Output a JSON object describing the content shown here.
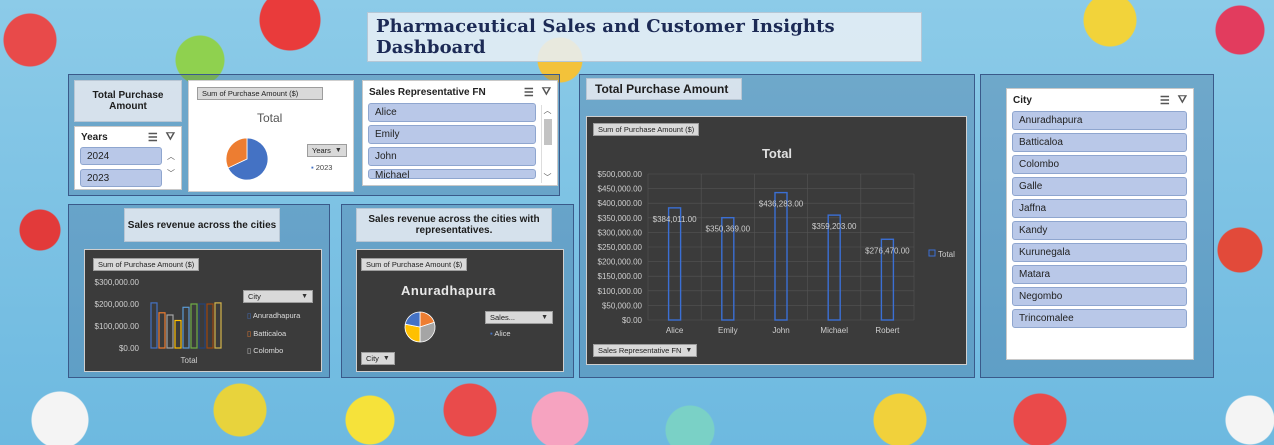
{
  "title": "Pharmaceutical Sales and Customer Insights Dashboard",
  "total_purchase_label": "Total Purchase Amount",
  "years_slicer": {
    "title": "Years",
    "items": [
      "2024",
      "2023"
    ]
  },
  "mini_pie": {
    "field": "Sum of Purchase Amount ($)",
    "title": "Total",
    "dropdown": "Years",
    "legend": "2023",
    "colors": [
      "#4472c4",
      "#ed7d31"
    ]
  },
  "rep_slicer": {
    "title": "Sales Representative FN",
    "items": [
      "Alice",
      "Emily",
      "John",
      "Michael"
    ]
  },
  "city_label": "Sales revenue across the cities",
  "city_chart": {
    "field": "Sum of Purchase Amount ($)",
    "dropdown": "City",
    "legend": [
      "Anuradhapura",
      "Batticaloa",
      "Colombo"
    ],
    "yticks": [
      "$300,000.00",
      "$200,000.00",
      "$100,000.00",
      "$0.00"
    ],
    "xlabel": "Total"
  },
  "rep_city_label": "Sales revenue across the cities with representatives.",
  "rep_city_chart": {
    "field": "Sum of Purchase Amount ($)",
    "title": "Anuradhapura",
    "dropdown": "Sales...",
    "legend": "Alice",
    "city_btn": "City"
  },
  "big_chart_label": "Total Purchase Amount",
  "big_chart_field": "Sum of Purchase Amount ($)",
  "big_chart_axis_btn": "Sales Representative FN",
  "city_slicer": {
    "title": "City",
    "items": [
      "Anuradhapura",
      "Batticaloa",
      "Colombo",
      "Galle",
      "Jaffna",
      "Kandy",
      "Kurunegala",
      "Matara",
      "Negombo",
      "Trincomalee"
    ]
  },
  "icons": {
    "multi_select": "multi-select-icon",
    "clear_filter": "clear-filter-icon"
  },
  "chart_data": [
    {
      "type": "bar",
      "title": "Total",
      "categories": [
        "Alice",
        "Emily",
        "John",
        "Michael",
        "Robert"
      ],
      "values": [
        384011.0,
        350369.0,
        436283.0,
        359203.0,
        276470.0
      ],
      "labels": [
        "$384,011.00",
        "$350,369.00",
        "$436,283.00",
        "$359,203.00",
        "$276,470.00"
      ],
      "yticks": [
        "$500,000.00",
        "$450,000.00",
        "$400,000.00",
        "$350,000.00",
        "$300,000.00",
        "$250,000.00",
        "$200,000.00",
        "$150,000.00",
        "$100,000.00",
        "$50,000.00",
        "$0.00"
      ],
      "ylim": [
        0,
        500000
      ],
      "legend": "Total",
      "color": "#3b6fd4"
    },
    {
      "type": "bar",
      "values": [
        205000,
        160000,
        150000,
        125000,
        185000,
        200000,
        200000,
        200000,
        205000
      ],
      "colors": [
        "#4472c4",
        "#ed7d31",
        "#a5a5a5",
        "#ffc000",
        "#5b9bd5",
        "#70ad47",
        "#264478",
        "#9e480e",
        "#d4b44a"
      ],
      "ylim": [
        0,
        300000
      ]
    },
    {
      "type": "pie",
      "values": [
        20,
        30,
        28,
        22
      ],
      "colors": [
        "#ed7d31",
        "#a5a5a5",
        "#ffc000",
        "#4472c4"
      ]
    },
    {
      "type": "pie",
      "values": [
        68,
        32
      ],
      "colors": [
        "#4472c4",
        "#ed7d31"
      ]
    }
  ]
}
